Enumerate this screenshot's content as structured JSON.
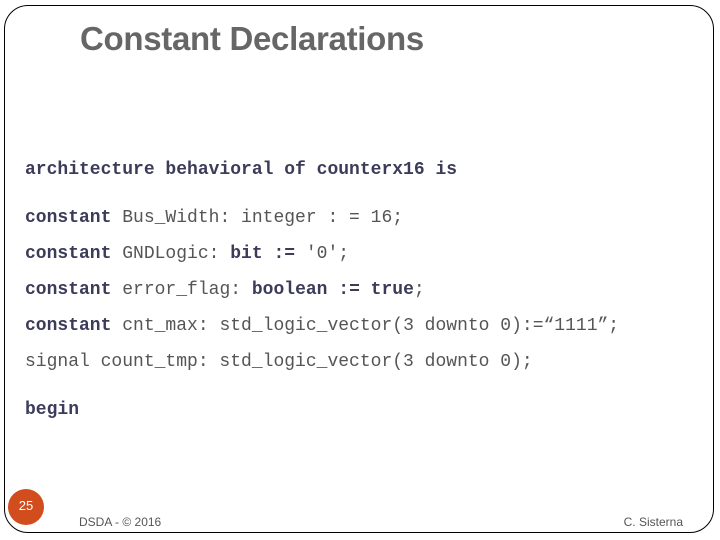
{
  "slide": {
    "title": "Constant Declarations",
    "code_lines": [
      [
        {
          "t": "architecture behavioral of counterx16 is",
          "kw": true
        }
      ],
      [
        {
          "t": "constant",
          "kw": true
        },
        {
          "t": " Bus_Width: integer : = 16;",
          "kw": false
        }
      ],
      [
        {
          "t": "constant",
          "kw": true
        },
        {
          "t": " GNDLogic: ",
          "kw": false
        },
        {
          "t": "bit :=",
          "kw": true
        },
        {
          "t": " '0';",
          "kw": false
        }
      ],
      [
        {
          "t": "constant",
          "kw": true
        },
        {
          "t": " error_flag: ",
          "kw": false
        },
        {
          "t": "boolean := true",
          "kw": true
        },
        {
          "t": ";",
          "kw": false
        }
      ],
      [
        {
          "t": "constant",
          "kw": true
        },
        {
          "t": " cnt_max: std_logic_vector(3 downto 0):=“1111”;",
          "kw": false
        }
      ],
      [
        {
          "t": "signal count_tmp: std_logic_vector(3 downto 0);",
          "kw": false
        }
      ],
      [
        {
          "t": "begin",
          "kw": true
        }
      ]
    ],
    "page_number": "25",
    "footer_left": "DSDA - © 2016",
    "footer_right": "C. Sisterna",
    "accent_color": "#d24d1d"
  }
}
